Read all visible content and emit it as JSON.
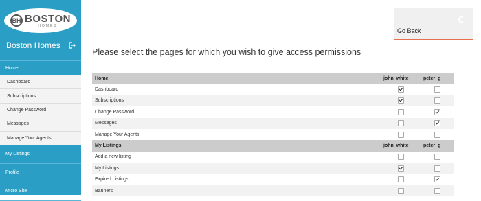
{
  "brand": {
    "name": "BOSTON",
    "sub": "HOMES",
    "mark": "BH"
  },
  "sidebar": {
    "site_title": "Boston Homes",
    "home_label": "Home",
    "home_items": [
      {
        "label": "Dashboard"
      },
      {
        "label": "Subscriptions"
      },
      {
        "label": "Change Password"
      },
      {
        "label": "Messages"
      },
      {
        "label": "Manage Your Agents"
      }
    ],
    "sections": [
      {
        "label": "My Listings"
      },
      {
        "label": "Profile"
      },
      {
        "label": "Micro Site"
      }
    ]
  },
  "goback": {
    "label": "Go Back"
  },
  "main": {
    "heading": "Please select the pages for which you wish to give access permissions",
    "users": [
      "john_white",
      "peter_g"
    ],
    "groups": [
      {
        "name": "Home",
        "rows": [
          {
            "label": "Dashboard",
            "john_white": true,
            "peter_g": false
          },
          {
            "label": "Subscriptions",
            "john_white": true,
            "peter_g": false
          },
          {
            "label": "Change Password",
            "john_white": false,
            "peter_g": true
          },
          {
            "label": "Messages",
            "john_white": false,
            "peter_g": true
          },
          {
            "label": "Manage Your Agents",
            "john_white": false,
            "peter_g": false
          }
        ]
      },
      {
        "name": "My Listings",
        "rows": [
          {
            "label": "Add a new listing",
            "john_white": false,
            "peter_g": false
          },
          {
            "label": "My Listings",
            "john_white": true,
            "peter_g": false
          },
          {
            "label": "Expired Listings",
            "john_white": false,
            "peter_g": true
          },
          {
            "label": "Banners",
            "john_white": false,
            "peter_g": false
          }
        ]
      }
    ]
  }
}
